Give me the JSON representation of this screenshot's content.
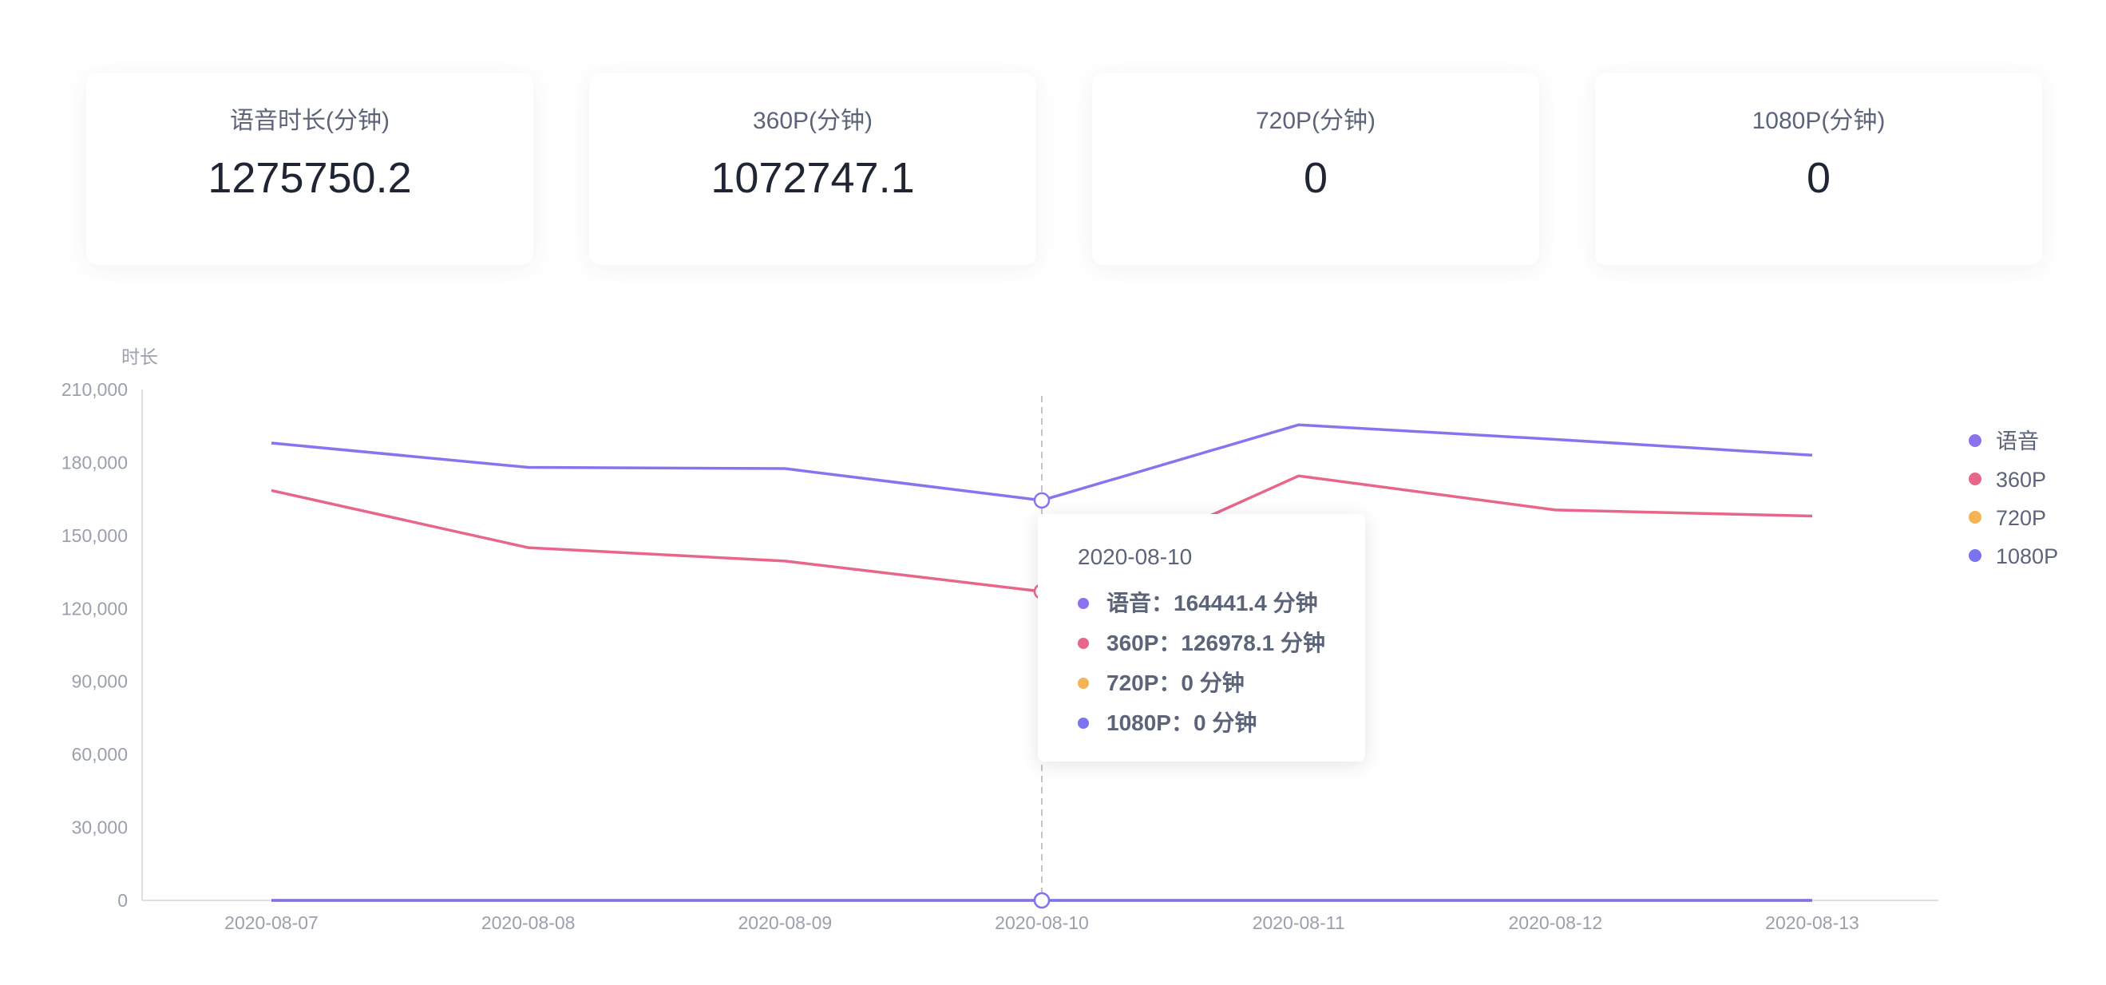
{
  "stats": [
    {
      "label": "语音时长(分钟)",
      "value": "1275750.2"
    },
    {
      "label": "360P(分钟)",
      "value": "1072747.1"
    },
    {
      "label": "720P(分钟)",
      "value": "0"
    },
    {
      "label": "1080P(分钟)",
      "value": "0"
    }
  ],
  "chart_data": {
    "type": "line",
    "ylabel": "时长",
    "xlabel": "",
    "ylim": [
      0,
      210000
    ],
    "yticks": [
      0,
      30000,
      60000,
      90000,
      120000,
      150000,
      180000,
      210000
    ],
    "ytick_labels": [
      "0",
      "30,000",
      "60,000",
      "90,000",
      "120,000",
      "150,000",
      "180,000",
      "210,000"
    ],
    "categories": [
      "2020-08-07",
      "2020-08-08",
      "2020-08-09",
      "2020-08-10",
      "2020-08-11",
      "2020-08-12",
      "2020-08-13"
    ],
    "series": [
      {
        "name": "语音",
        "color": "#8b73ef",
        "values": [
          188000,
          178000,
          177500,
          164441.4,
          195500,
          189500,
          183000
        ]
      },
      {
        "name": "360P",
        "color": "#e8668a",
        "values": [
          168500,
          145000,
          139500,
          126978.1,
          174500,
          160500,
          158000
        ]
      },
      {
        "name": "720P",
        "color": "#f5b454",
        "values": [
          0,
          0,
          0,
          0,
          0,
          0,
          0
        ]
      },
      {
        "name": "1080P",
        "color": "#7b73ef",
        "values": [
          0,
          0,
          0,
          0,
          0,
          0,
          0
        ]
      }
    ],
    "legend_position": "right",
    "grid": false,
    "highlight_category": "2020-08-10"
  },
  "tooltip": {
    "title": "2020-08-10",
    "rows": [
      {
        "text": "语音：164441.4 分钟",
        "color": "#8b73ef"
      },
      {
        "text": "360P：126978.1 分钟",
        "color": "#e8668a"
      },
      {
        "text": "720P：0 分钟",
        "color": "#f5b454"
      },
      {
        "text": "1080P：0 分钟",
        "color": "#7b73ef"
      }
    ]
  }
}
